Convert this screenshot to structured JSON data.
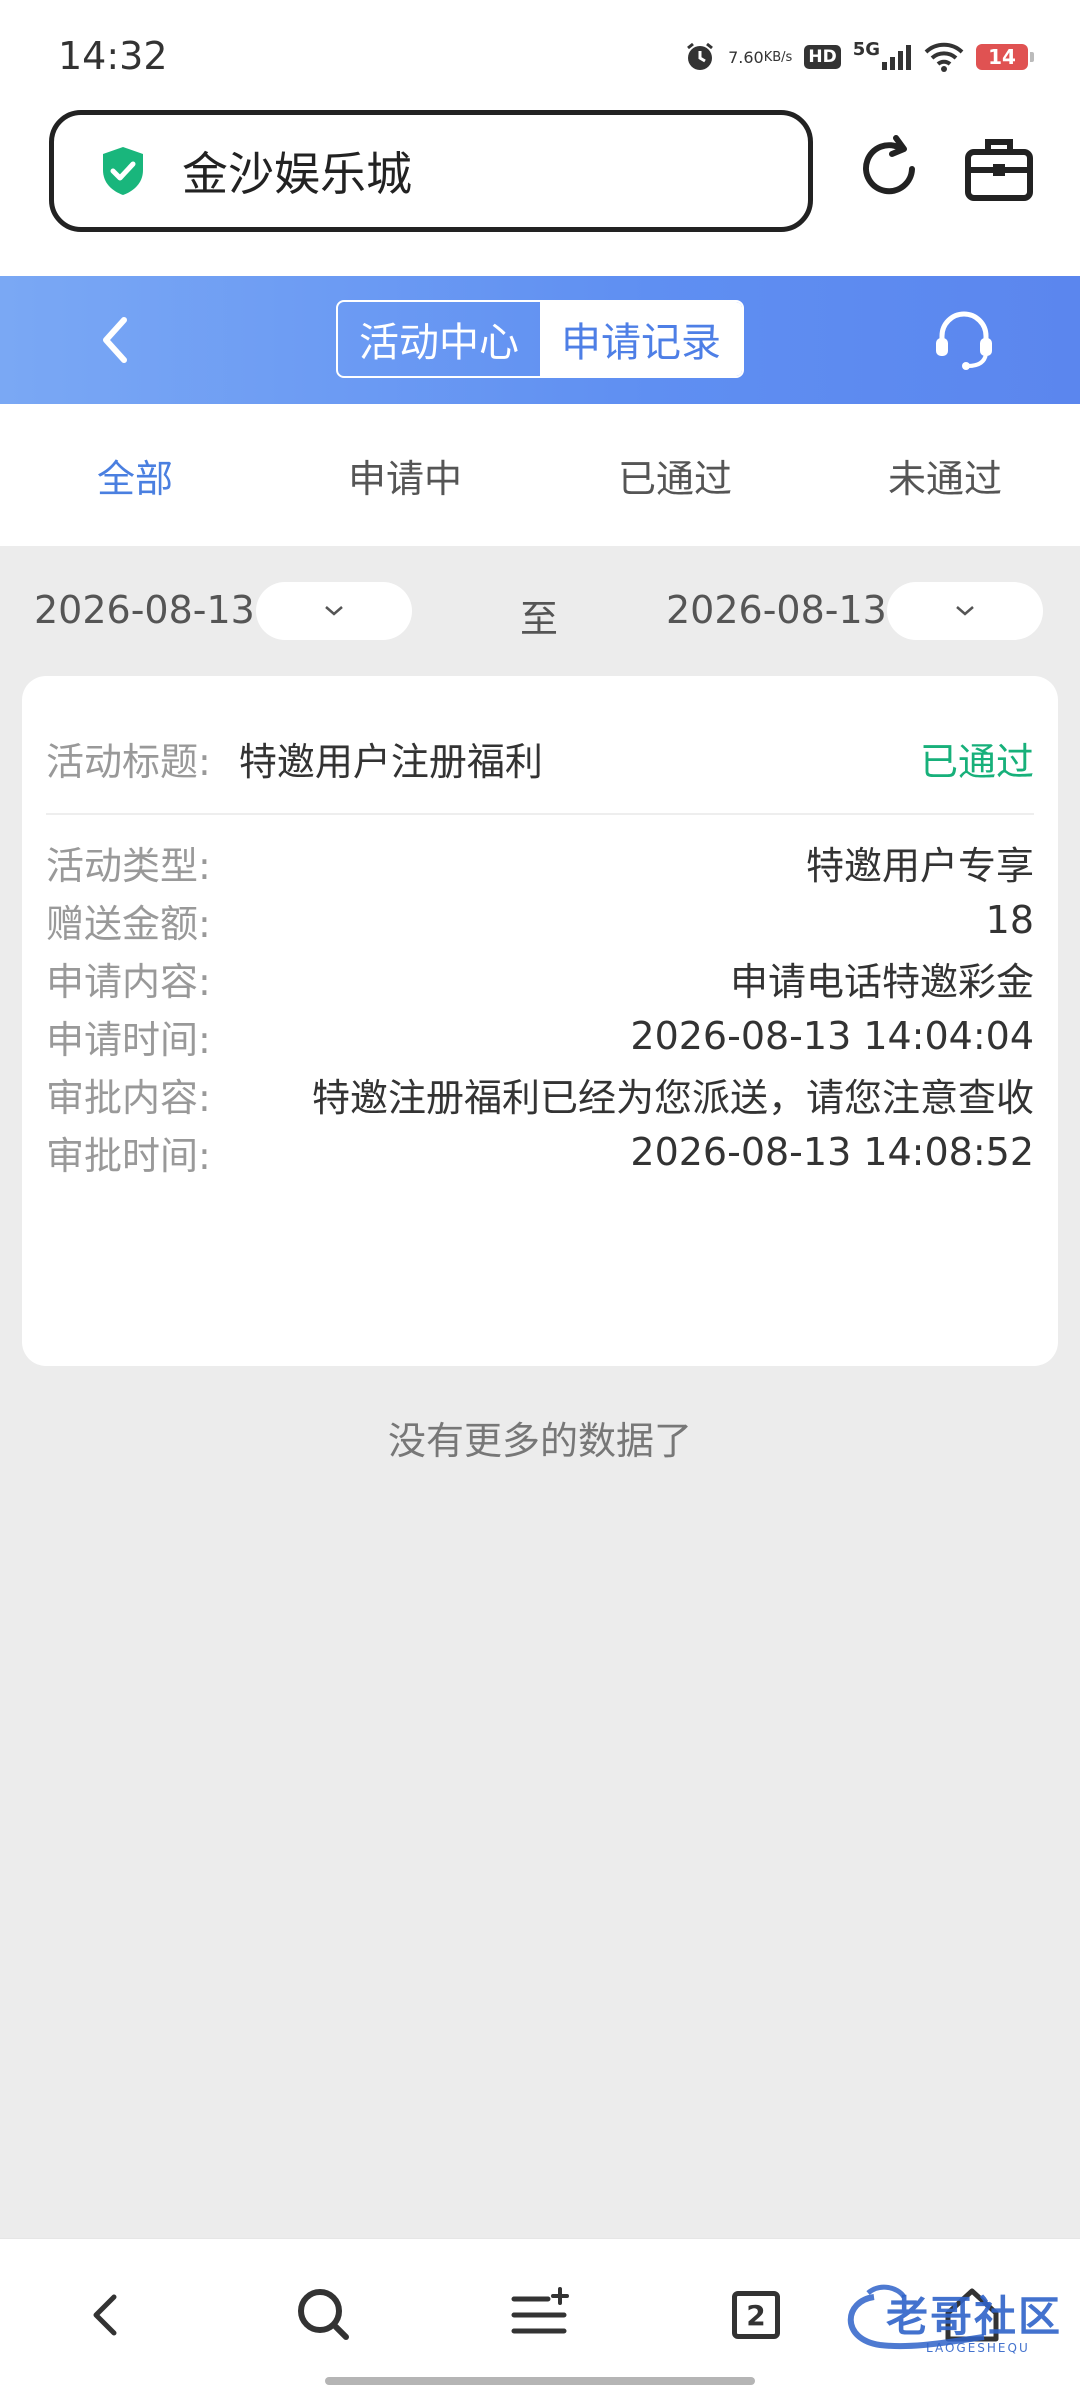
{
  "status_bar": {
    "time": "14:32",
    "net_speed_value": "7.60",
    "net_speed_unit": "KB/s",
    "hd_label": "HD",
    "network_label": "5G",
    "battery": "14"
  },
  "browser": {
    "url_title": "金沙娱乐城"
  },
  "header": {
    "segments": [
      "活动中心",
      "申请记录"
    ],
    "active_segment": "申请记录"
  },
  "tabs": {
    "items": [
      "全部",
      "申请中",
      "已通过",
      "未通过"
    ],
    "active": "全部"
  },
  "date_filter": {
    "start": "2026-08-13",
    "separator": "至",
    "end": "2026-08-13"
  },
  "record": {
    "title_label": "活动标题:",
    "title_value": "特邀用户注册福利",
    "status": "已通过",
    "rows": [
      {
        "label": "活动类型:",
        "value": "特邀用户专享"
      },
      {
        "label": "赠送金额:",
        "value": "18"
      },
      {
        "label": "申请内容:",
        "value": "申请电话特邀彩金"
      },
      {
        "label": "申请时间:",
        "value": "2026-08-13 14:04:04"
      },
      {
        "label": "审批内容:",
        "value": "特邀注册福利已经为您派送，请您注意查收"
      },
      {
        "label": "审批时间:",
        "value": "2026-08-13 14:08:52"
      }
    ]
  },
  "footer_text": "没有更多的数据了",
  "bottom_nav": {
    "tab_count": "2",
    "watermark": "老哥社区",
    "watermark_sub": "LAOGESHEQU"
  },
  "colors": {
    "header_blue": "#5f8ff2",
    "active_tab": "#4a7fe0",
    "status_green": "#17b07a",
    "shield_green": "#19b67c"
  }
}
